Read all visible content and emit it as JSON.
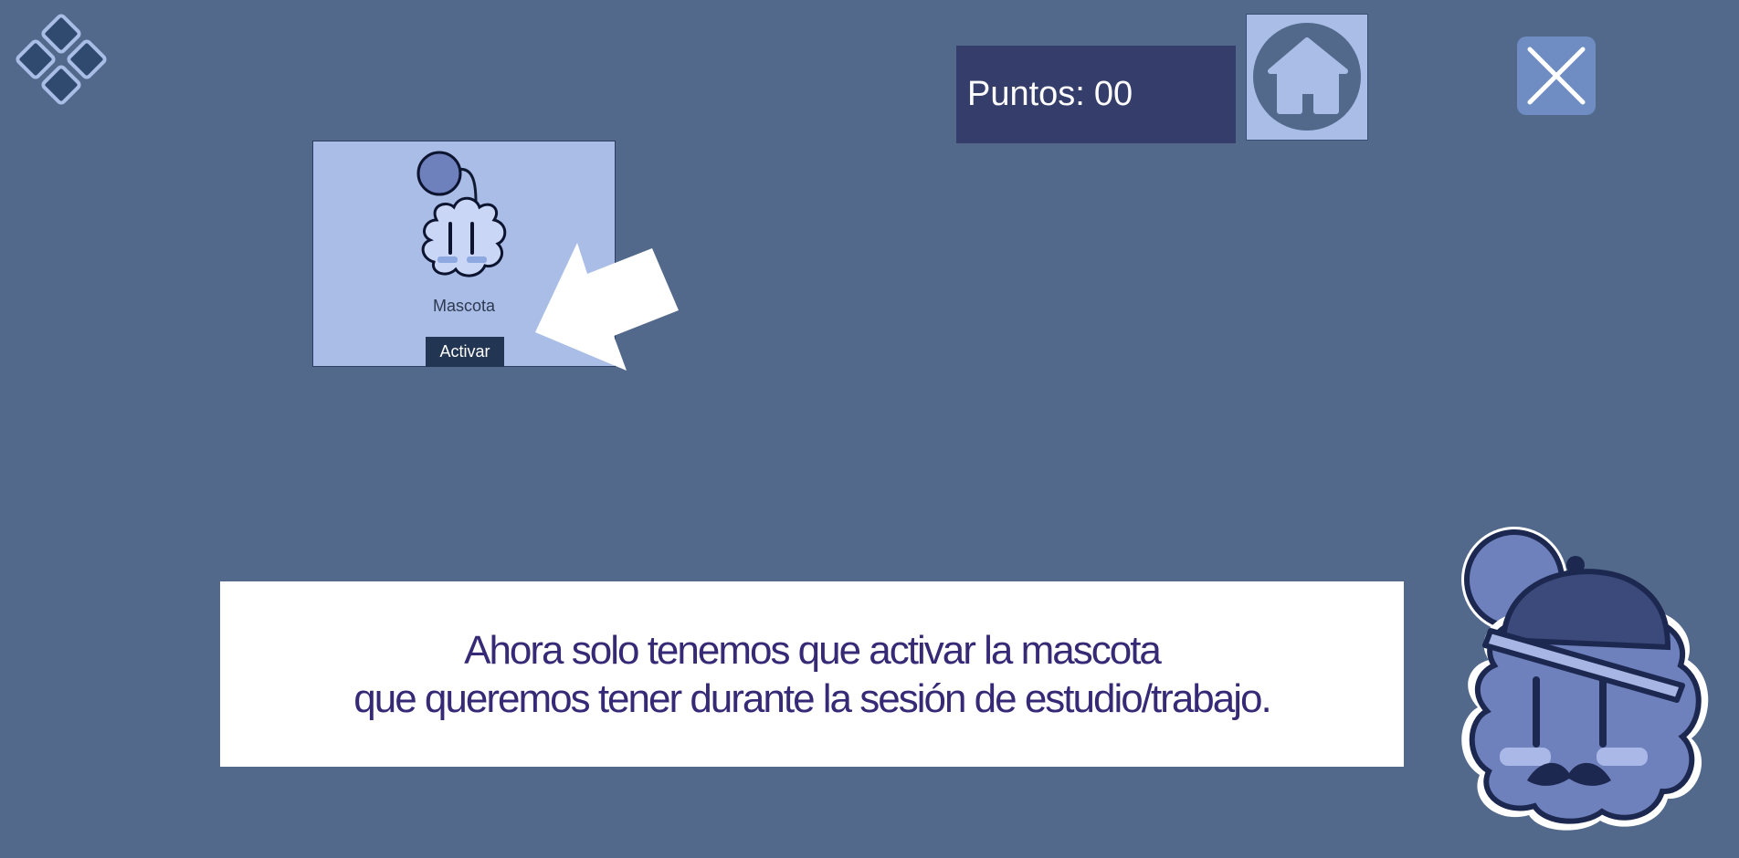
{
  "icons": {
    "menu": "diamond-grid-icon",
    "home": "house-icon",
    "close": "close-x-icon",
    "pointer": "arrow-icon"
  },
  "score": {
    "label": "Puntos:",
    "value": "00"
  },
  "card": {
    "name": "Mascota",
    "button_label": "Activar"
  },
  "dialog": {
    "line1": "Ahora solo tenemos que activar la mascota",
    "line2": "que queremos tener durante la sesión de estudio/trabajo."
  },
  "colors": {
    "background": "#52698b",
    "score_panel": "#353d6b",
    "card": "#a9bde6",
    "button": "#223654",
    "dialog_text": "#362a77",
    "mascot_body": "#6f81bd",
    "mascot_outline": "#1d2850"
  }
}
